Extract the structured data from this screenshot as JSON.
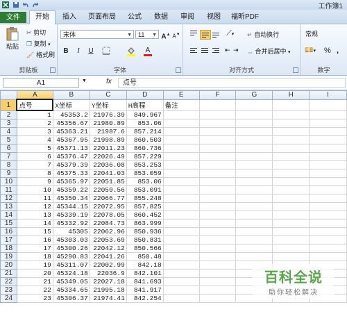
{
  "title_bar": {
    "app_title": "工作簿1"
  },
  "tabs": [
    {
      "label": "文件"
    },
    {
      "label": "开始"
    },
    {
      "label": "插入"
    },
    {
      "label": "页面布局"
    },
    {
      "label": "公式"
    },
    {
      "label": "数据"
    },
    {
      "label": "审阅"
    },
    {
      "label": "视图"
    },
    {
      "label": "福昕PDF"
    }
  ],
  "ribbon": {
    "clipboard": {
      "paste": "粘贴",
      "cut": "剪切",
      "copy": "复制",
      "format_painter": "格式刷",
      "label": "剪贴板"
    },
    "font": {
      "name": "宋体",
      "size": "11",
      "label": "字体",
      "bold": "B",
      "italic": "I",
      "underline": "U",
      "grow": "A",
      "shrink": "A",
      "font_color": "A"
    },
    "alignment": {
      "wrap": "自动换行",
      "merge": "合并后居中",
      "label": "对齐方式"
    },
    "number": {
      "format": "常规",
      "label": "数字",
      "percent": "%",
      "comma": ","
    }
  },
  "formula_bar": {
    "name_box": "A1",
    "fx": "fx",
    "content": "点号"
  },
  "sheet": {
    "columns": [
      "A",
      "B",
      "C",
      "D",
      "E",
      "F",
      "G",
      "H",
      "I"
    ],
    "rows": [
      [
        "1",
        "点号",
        "X坐标",
        "Y坐标",
        "H高程",
        "备注"
      ],
      [
        "2",
        "1",
        "45353.2",
        "21976.39",
        "849.967",
        ""
      ],
      [
        "3",
        "2",
        "45356.67",
        "21980.89",
        "853.06",
        ""
      ],
      [
        "4",
        "3",
        "45363.21",
        "21987.6",
        "857.214",
        ""
      ],
      [
        "5",
        "4",
        "45367.95",
        "21998.89",
        "860.503",
        ""
      ],
      [
        "6",
        "5",
        "45371.13",
        "22011.23",
        "860.736",
        ""
      ],
      [
        "7",
        "6",
        "45376.47",
        "22026.49",
        "857.229",
        ""
      ],
      [
        "8",
        "7",
        "45379.39",
        "22036.08",
        "853.253",
        ""
      ],
      [
        "9",
        "8",
        "45375.33",
        "22041.03",
        "853.059",
        ""
      ],
      [
        "10",
        "9",
        "45365.97",
        "22051.85",
        "853.06",
        ""
      ],
      [
        "11",
        "10",
        "45359.22",
        "22059.56",
        "853.091",
        ""
      ],
      [
        "12",
        "11",
        "45350.34",
        "22066.77",
        "855.248",
        ""
      ],
      [
        "13",
        "12",
        "45344.15",
        "22072.95",
        "857.825",
        ""
      ],
      [
        "14",
        "13",
        "45339.19",
        "22078.05",
        "860.452",
        ""
      ],
      [
        "15",
        "14",
        "45332.92",
        "22084.73",
        "863.999",
        ""
      ],
      [
        "16",
        "15",
        "45305",
        "22062.96",
        "850.936",
        ""
      ],
      [
        "17",
        "16",
        "45303.03",
        "22053.69",
        "850.831",
        ""
      ],
      [
        "18",
        "17",
        "45300.26",
        "22042.12",
        "850.566",
        ""
      ],
      [
        "19",
        "18",
        "45290.83",
        "22041.26",
        "850.48",
        ""
      ],
      [
        "20",
        "19",
        "45311.07",
        "22002.99",
        "842.18",
        ""
      ],
      [
        "21",
        "20",
        "45324.18",
        "22036.9",
        "842.101",
        ""
      ],
      [
        "22",
        "21",
        "45349.05",
        "22027.18",
        "841.693",
        ""
      ],
      [
        "23",
        "22",
        "45334.65",
        "21995.18",
        "841.917",
        ""
      ],
      [
        "24",
        "23",
        "45306.37",
        "21974.41",
        "842.254",
        ""
      ]
    ]
  },
  "watermark": {
    "line1": "百科全说",
    "line2": "助你轻松解决"
  },
  "colors": {
    "file_tab": "#2e7d32",
    "selected_header": "#f6cf6a",
    "watermark_green": "#5aa64a"
  }
}
